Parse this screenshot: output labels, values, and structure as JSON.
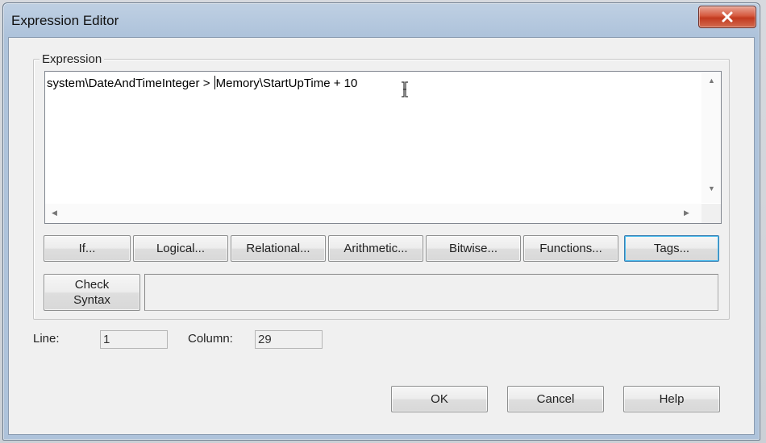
{
  "window": {
    "title": "Expression Editor",
    "close_icon": "close-icon"
  },
  "expression": {
    "group_label": "Expression",
    "text_before_caret": "system\\DateAndTimeInteger > ",
    "text_after_caret": "Memory\\StartUpTime + 10"
  },
  "operator_buttons": {
    "if": "If...",
    "logical": "Logical...",
    "relational": "Relational...",
    "arithmetic": "Arithmetic...",
    "bitwise": "Bitwise...",
    "functions": "Functions...",
    "tags": "Tags..."
  },
  "check_syntax": {
    "line1": "Check",
    "line2": "Syntax",
    "result_text": ""
  },
  "position": {
    "line_label": "Line:",
    "line_value": "1",
    "column_label": "Column:",
    "column_value": "29"
  },
  "footer": {
    "ok": "OK",
    "cancel": "Cancel",
    "help": "Help"
  }
}
